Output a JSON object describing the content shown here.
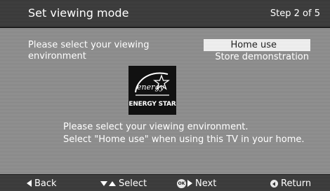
{
  "header": {
    "title": "Set viewing mode",
    "step": "Step 2 of 5"
  },
  "prompt": "Please select your viewing environment",
  "options": [
    {
      "label": "Home use",
      "selected": true
    },
    {
      "label": "Store demonstration",
      "selected": false
    }
  ],
  "logo": {
    "script_text": "energy",
    "label": "ENERGY STAR"
  },
  "description": {
    "line1": "Please select your viewing environment.",
    "line2": "Select \"Home use\" when using this TV in your home."
  },
  "footer": {
    "back": {
      "icon": "left-triangle-icon",
      "label": "Back"
    },
    "select": {
      "icon": "up-down-triangles-icon",
      "label": "Select"
    },
    "next": {
      "icon": "ok-button-icon",
      "ok_text": "OK",
      "label": "Next"
    },
    "return": {
      "icon": "return-icon",
      "label": "Return"
    }
  },
  "colors": {
    "background": "#8f8f8f",
    "bar": "#3a3a3a",
    "highlight": "#ececec",
    "logo_bg": "#111111"
  }
}
